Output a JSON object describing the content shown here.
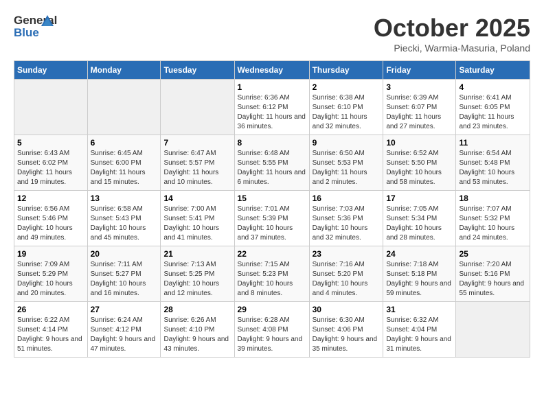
{
  "logo": {
    "text_general": "General",
    "text_blue": "Blue"
  },
  "title": {
    "month": "October 2025",
    "location": "Piecki, Warmia-Masuria, Poland"
  },
  "headers": [
    "Sunday",
    "Monday",
    "Tuesday",
    "Wednesday",
    "Thursday",
    "Friday",
    "Saturday"
  ],
  "weeks": [
    [
      {
        "day": "",
        "info": ""
      },
      {
        "day": "",
        "info": ""
      },
      {
        "day": "",
        "info": ""
      },
      {
        "day": "1",
        "info": "Sunrise: 6:36 AM\nSunset: 6:12 PM\nDaylight: 11 hours and 36 minutes."
      },
      {
        "day": "2",
        "info": "Sunrise: 6:38 AM\nSunset: 6:10 PM\nDaylight: 11 hours and 32 minutes."
      },
      {
        "day": "3",
        "info": "Sunrise: 6:39 AM\nSunset: 6:07 PM\nDaylight: 11 hours and 27 minutes."
      },
      {
        "day": "4",
        "info": "Sunrise: 6:41 AM\nSunset: 6:05 PM\nDaylight: 11 hours and 23 minutes."
      }
    ],
    [
      {
        "day": "5",
        "info": "Sunrise: 6:43 AM\nSunset: 6:02 PM\nDaylight: 11 hours and 19 minutes."
      },
      {
        "day": "6",
        "info": "Sunrise: 6:45 AM\nSunset: 6:00 PM\nDaylight: 11 hours and 15 minutes."
      },
      {
        "day": "7",
        "info": "Sunrise: 6:47 AM\nSunset: 5:57 PM\nDaylight: 11 hours and 10 minutes."
      },
      {
        "day": "8",
        "info": "Sunrise: 6:48 AM\nSunset: 5:55 PM\nDaylight: 11 hours and 6 minutes."
      },
      {
        "day": "9",
        "info": "Sunrise: 6:50 AM\nSunset: 5:53 PM\nDaylight: 11 hours and 2 minutes."
      },
      {
        "day": "10",
        "info": "Sunrise: 6:52 AM\nSunset: 5:50 PM\nDaylight: 10 hours and 58 minutes."
      },
      {
        "day": "11",
        "info": "Sunrise: 6:54 AM\nSunset: 5:48 PM\nDaylight: 10 hours and 53 minutes."
      }
    ],
    [
      {
        "day": "12",
        "info": "Sunrise: 6:56 AM\nSunset: 5:46 PM\nDaylight: 10 hours and 49 minutes."
      },
      {
        "day": "13",
        "info": "Sunrise: 6:58 AM\nSunset: 5:43 PM\nDaylight: 10 hours and 45 minutes."
      },
      {
        "day": "14",
        "info": "Sunrise: 7:00 AM\nSunset: 5:41 PM\nDaylight: 10 hours and 41 minutes."
      },
      {
        "day": "15",
        "info": "Sunrise: 7:01 AM\nSunset: 5:39 PM\nDaylight: 10 hours and 37 minutes."
      },
      {
        "day": "16",
        "info": "Sunrise: 7:03 AM\nSunset: 5:36 PM\nDaylight: 10 hours and 32 minutes."
      },
      {
        "day": "17",
        "info": "Sunrise: 7:05 AM\nSunset: 5:34 PM\nDaylight: 10 hours and 28 minutes."
      },
      {
        "day": "18",
        "info": "Sunrise: 7:07 AM\nSunset: 5:32 PM\nDaylight: 10 hours and 24 minutes."
      }
    ],
    [
      {
        "day": "19",
        "info": "Sunrise: 7:09 AM\nSunset: 5:29 PM\nDaylight: 10 hours and 20 minutes."
      },
      {
        "day": "20",
        "info": "Sunrise: 7:11 AM\nSunset: 5:27 PM\nDaylight: 10 hours and 16 minutes."
      },
      {
        "day": "21",
        "info": "Sunrise: 7:13 AM\nSunset: 5:25 PM\nDaylight: 10 hours and 12 minutes."
      },
      {
        "day": "22",
        "info": "Sunrise: 7:15 AM\nSunset: 5:23 PM\nDaylight: 10 hours and 8 minutes."
      },
      {
        "day": "23",
        "info": "Sunrise: 7:16 AM\nSunset: 5:20 PM\nDaylight: 10 hours and 4 minutes."
      },
      {
        "day": "24",
        "info": "Sunrise: 7:18 AM\nSunset: 5:18 PM\nDaylight: 9 hours and 59 minutes."
      },
      {
        "day": "25",
        "info": "Sunrise: 7:20 AM\nSunset: 5:16 PM\nDaylight: 9 hours and 55 minutes."
      }
    ],
    [
      {
        "day": "26",
        "info": "Sunrise: 6:22 AM\nSunset: 4:14 PM\nDaylight: 9 hours and 51 minutes."
      },
      {
        "day": "27",
        "info": "Sunrise: 6:24 AM\nSunset: 4:12 PM\nDaylight: 9 hours and 47 minutes."
      },
      {
        "day": "28",
        "info": "Sunrise: 6:26 AM\nSunset: 4:10 PM\nDaylight: 9 hours and 43 minutes."
      },
      {
        "day": "29",
        "info": "Sunrise: 6:28 AM\nSunset: 4:08 PM\nDaylight: 9 hours and 39 minutes."
      },
      {
        "day": "30",
        "info": "Sunrise: 6:30 AM\nSunset: 4:06 PM\nDaylight: 9 hours and 35 minutes."
      },
      {
        "day": "31",
        "info": "Sunrise: 6:32 AM\nSunset: 4:04 PM\nDaylight: 9 hours and 31 minutes."
      },
      {
        "day": "",
        "info": ""
      }
    ]
  ]
}
